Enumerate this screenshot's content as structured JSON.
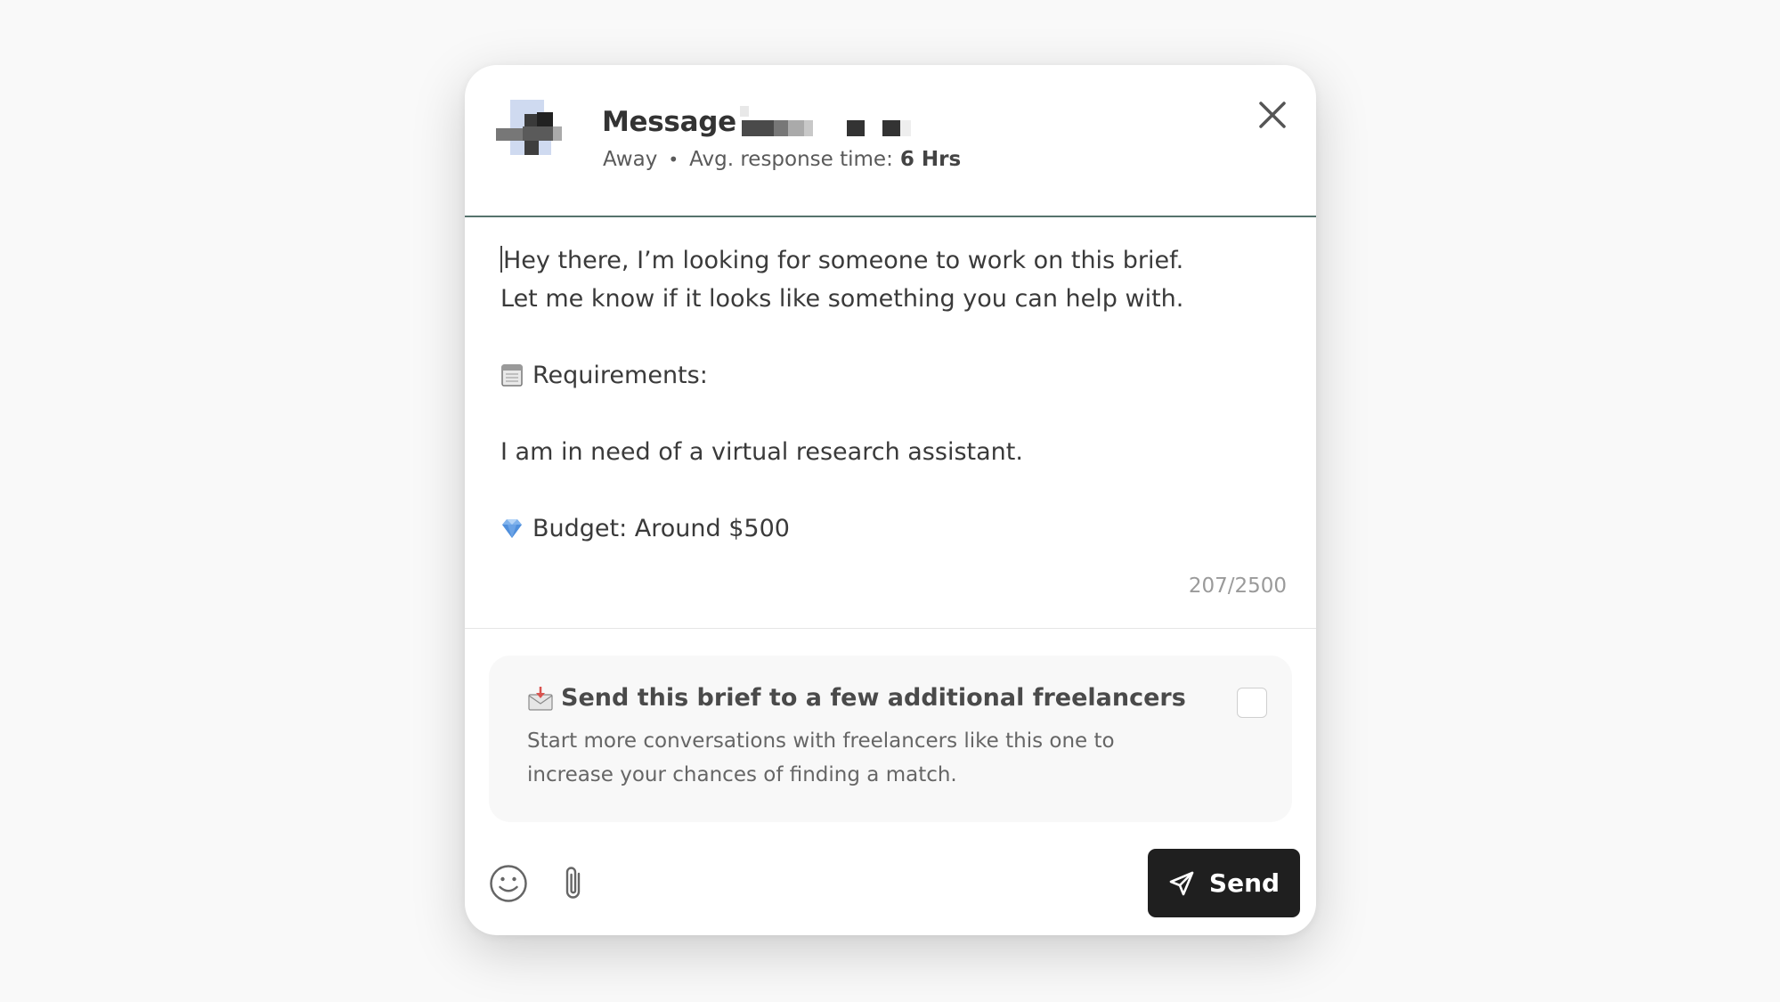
{
  "header": {
    "title": "Message",
    "status": "Away",
    "separator": "•",
    "response_label": "Avg. response time:",
    "response_value": "6 Hrs"
  },
  "message": {
    "line1": "Hey there, I’m looking for someone to work on this brief.",
    "line2": "Let me know if it looks like something you can help with.",
    "requirements_label": "Requirements:",
    "requirements_text": "I am in need of a virtual research assistant.",
    "budget_label": "Budget: Around $500",
    "char_count": "207/2500"
  },
  "upsell": {
    "title": "Send this brief to a few additional freelancers",
    "desc_line1": "Start more conversations with freelancers like this one to",
    "desc_line2": "increase your chances of finding a match.",
    "checked": false
  },
  "footer": {
    "send_label": "Send"
  },
  "icons": {
    "close": "close-icon",
    "requirements": "clipboard-icon",
    "budget": "gem-icon",
    "upsell": "envelope-icon",
    "emoji": "smiley-icon",
    "attach": "paperclip-icon",
    "send": "paper-plane-icon"
  }
}
